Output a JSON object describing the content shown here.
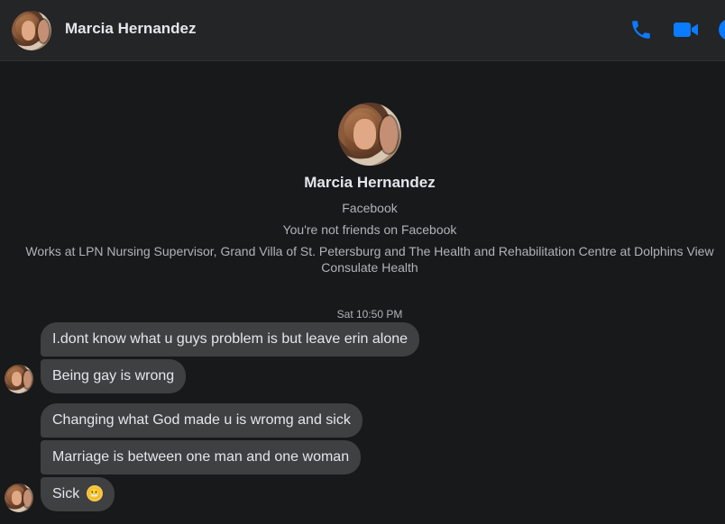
{
  "header": {
    "contact_name": "Marcia Hernandez",
    "icons": [
      "phone-icon",
      "video-camera-icon",
      "info-icon"
    ],
    "accent_color": "#0a7cff"
  },
  "profile": {
    "name": "Marcia Hernandez",
    "platform": "Facebook",
    "friend_status": "You're not friends on Facebook",
    "work_line_1": "Works at LPN Nursing Supervisor, Grand Villa of St. Petersburg and The Health and Rehabilitation Centre at Dolphins View",
    "work_line_2": "Consulate Health"
  },
  "conversation": {
    "timestamp": "Sat 10:50 PM",
    "messages": [
      {
        "text": "I.dont know what u guys problem is but leave erin alone"
      },
      {
        "text": "Being gay is wrong"
      },
      {
        "text": "Changing what God made u is wromg and sick"
      },
      {
        "text": "Marriage is between one man and one woman"
      },
      {
        "text": "Sick",
        "emoji": "grimacing-face-emoji",
        "emoji_glyph": "😬"
      }
    ]
  },
  "colors": {
    "background": "#18191a",
    "header_background": "#242526",
    "bubble_background": "#3e4042",
    "text_primary": "#e4e6eb",
    "text_secondary": "#b0b3b8"
  }
}
